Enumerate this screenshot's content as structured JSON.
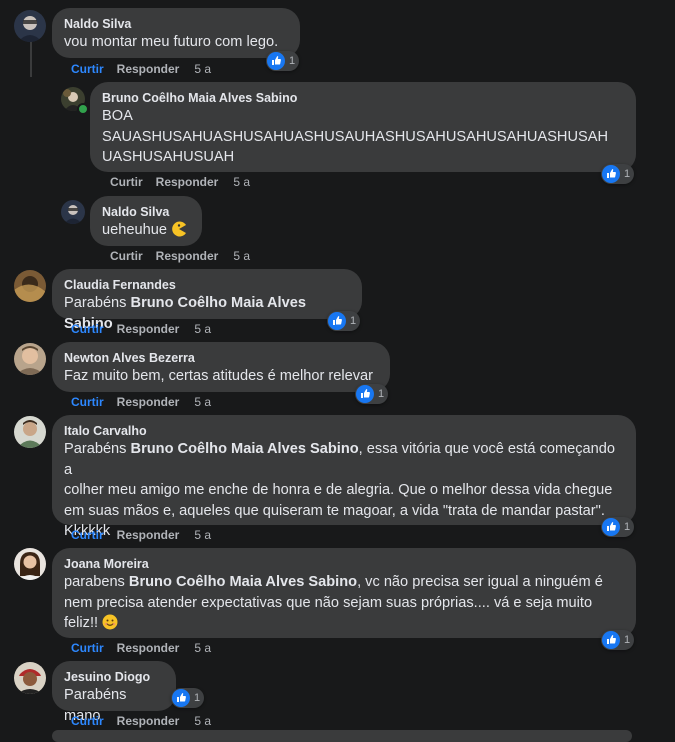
{
  "actions": {
    "like": "Curtir",
    "reply": "Responder"
  },
  "comments": [
    {
      "name": "Naldo Silva",
      "text": "vou montar meu futuro com lego.",
      "time": "5 a",
      "reactions": "1"
    },
    {
      "name": "Bruno Coêlho Maia Alves Sabino",
      "text_lines": [
        "BOA",
        "SAUASHUSAHUASHUSAHUASHUSAUHASHUSAHUSAHUSAHUASHUSAH",
        "UASHUSAHUSUAH"
      ],
      "time": "5 a",
      "reactions": "1"
    },
    {
      "name": "Naldo Silva",
      "text": "ueheuhue",
      "emoji": "pacman",
      "time": "5 a"
    },
    {
      "name": "Claudia Fernandes",
      "prefix": "Parabéns ",
      "mention": "Bruno Coêlho Maia Alves Sabino",
      "time": "5 a",
      "reactions": "1"
    },
    {
      "name": "Newton Alves Bezerra",
      "text": "Faz muito bem, certas atitudes é melhor relevar",
      "time": "5 a",
      "reactions": "1"
    },
    {
      "name": "Italo Carvalho",
      "lines": [
        "Parabéns ",
        "Bruno Coêlho Maia Alves Sabino",
        ", essa vitória que você está começando a",
        "colher meu amigo me enche de honra e de alegria. Que o melhor dessa vida chegue",
        "em suas mãos e, aqueles que quiseram te magoar, a vida \"trata de mandar pastar\".",
        "Kkkkkk"
      ],
      "time": "5 a",
      "reactions": "1"
    },
    {
      "name": "Joana Moreira",
      "lines": [
        "parabens ",
        "Bruno Coêlho Maia Alves Sabino",
        ", vc não precisa ser igual a ninguém é",
        "nem precisa atender expectativas que não sejam suas próprias.... vá e seja muito",
        "feliz!! "
      ],
      "emoji": "smile",
      "time": "5 a",
      "reactions": "1"
    },
    {
      "name": "Jesuino Diogo",
      "text": "Parabéns mano",
      "time": "5 a",
      "reactions": "1"
    }
  ],
  "colors": {
    "bubble": "#3a3b3c",
    "background": "#18191a",
    "like_blue": "#2d88ff",
    "online_green": "#31a24c"
  }
}
